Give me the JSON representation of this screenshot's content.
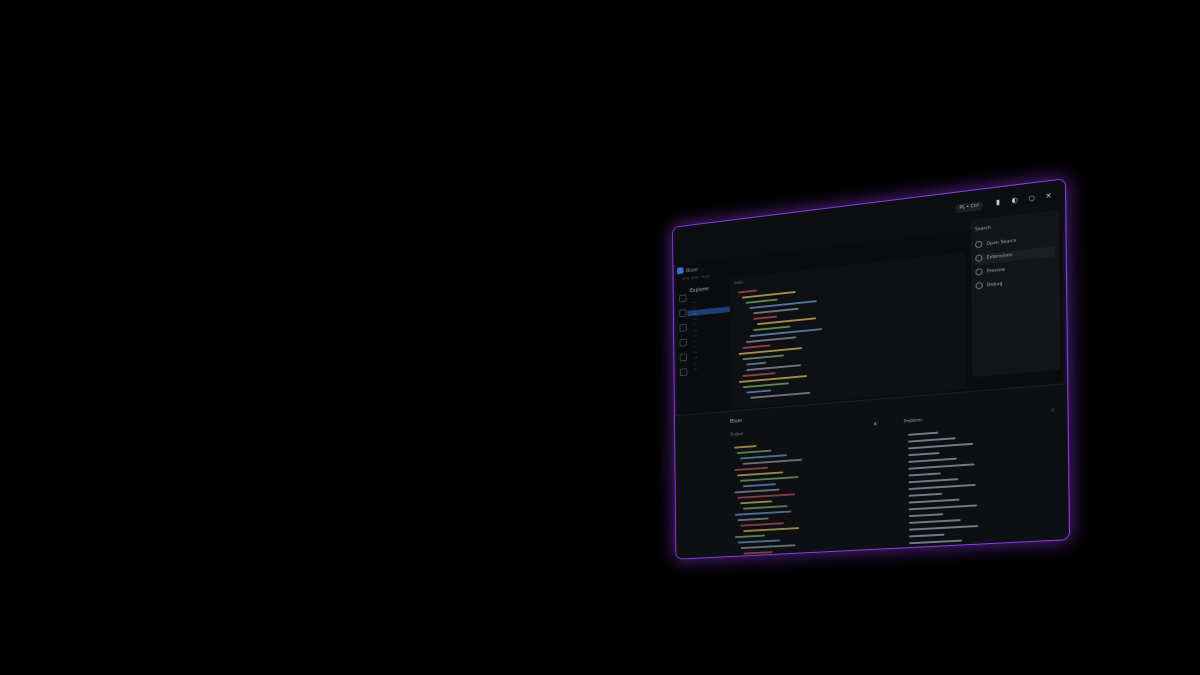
{
  "app": {
    "title": "Bluer",
    "menu": "File Edit View",
    "badge": "PL • Ctrl"
  },
  "tree": {
    "title": "Explorer",
    "items": [
      "…",
      "…",
      "…",
      "…",
      "…",
      "…",
      "…",
      "…",
      "…",
      "…",
      "…",
      "…",
      "…"
    ]
  },
  "editor": {
    "tab": "main"
  },
  "right_panel": {
    "search": "Search",
    "items": [
      "Open Source",
      "Extensions",
      "Preview",
      "Debug"
    ]
  },
  "bottom": {
    "title": "Bluer",
    "sub_left": "Output",
    "sub_right": "Problems"
  },
  "colors": {
    "accent": "#8b3fe6",
    "selection": "#1e3f75",
    "background": "#000000"
  }
}
